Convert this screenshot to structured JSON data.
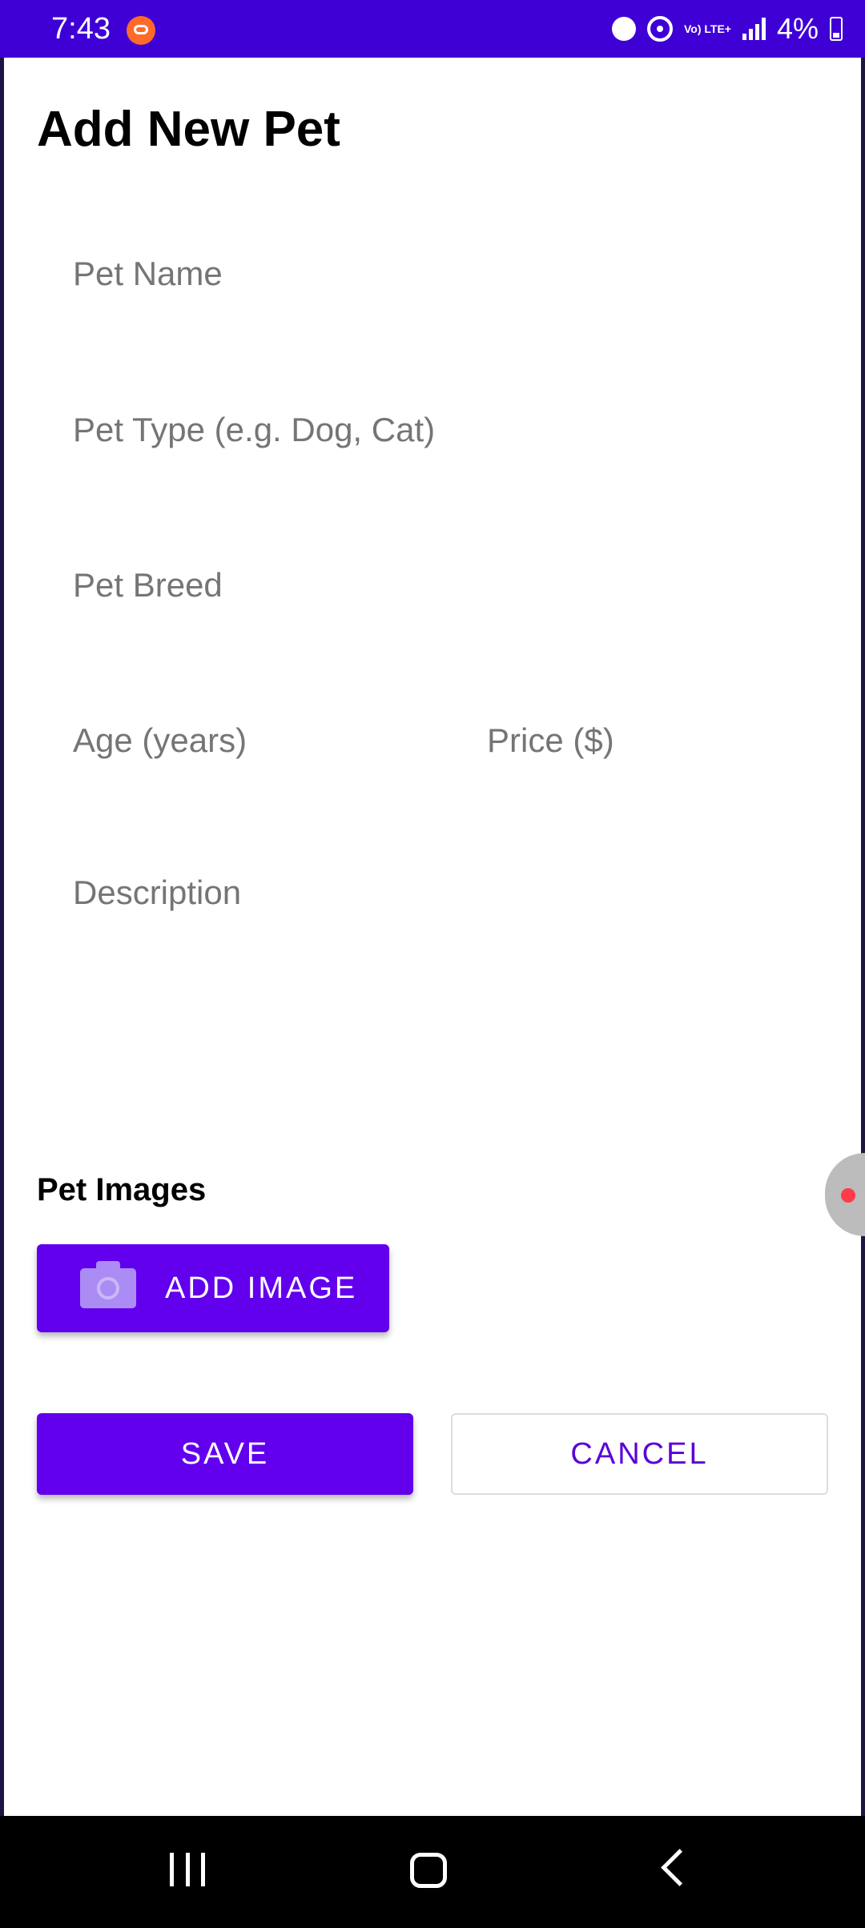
{
  "status_bar": {
    "time": "7:43",
    "battery_text": "4%",
    "network_label": "Vo) LTE+",
    "colors": {
      "background": "#3f00d6"
    },
    "icons": [
      "app-notification-icon",
      "alarm-icon",
      "hotspot-icon",
      "lte-icon",
      "signal-icon",
      "battery-icon"
    ]
  },
  "header": {
    "title": "Add New Pet"
  },
  "form": {
    "pet_name": {
      "value": "",
      "placeholder": "Pet Name"
    },
    "pet_type": {
      "value": "",
      "placeholder": "Pet Type (e.g. Dog, Cat)"
    },
    "pet_breed": {
      "value": "",
      "placeholder": "Pet Breed"
    },
    "age": {
      "value": "",
      "placeholder": "Age (years)"
    },
    "price": {
      "value": "",
      "placeholder": "Price ($)"
    },
    "description": {
      "value": "",
      "placeholder": "Description"
    }
  },
  "images_section": {
    "title": "Pet Images",
    "add_image_label": "ADD IMAGE",
    "add_image_icon": "camera-icon"
  },
  "actions": {
    "save_label": "SAVE",
    "cancel_label": "CANCEL"
  },
  "nav_bar": {
    "icons": [
      "recents-icon",
      "home-icon",
      "back-icon"
    ]
  },
  "theme": {
    "primary": "#6200ee",
    "primary_text": "#5a00d8",
    "placeholder": "#757575"
  }
}
